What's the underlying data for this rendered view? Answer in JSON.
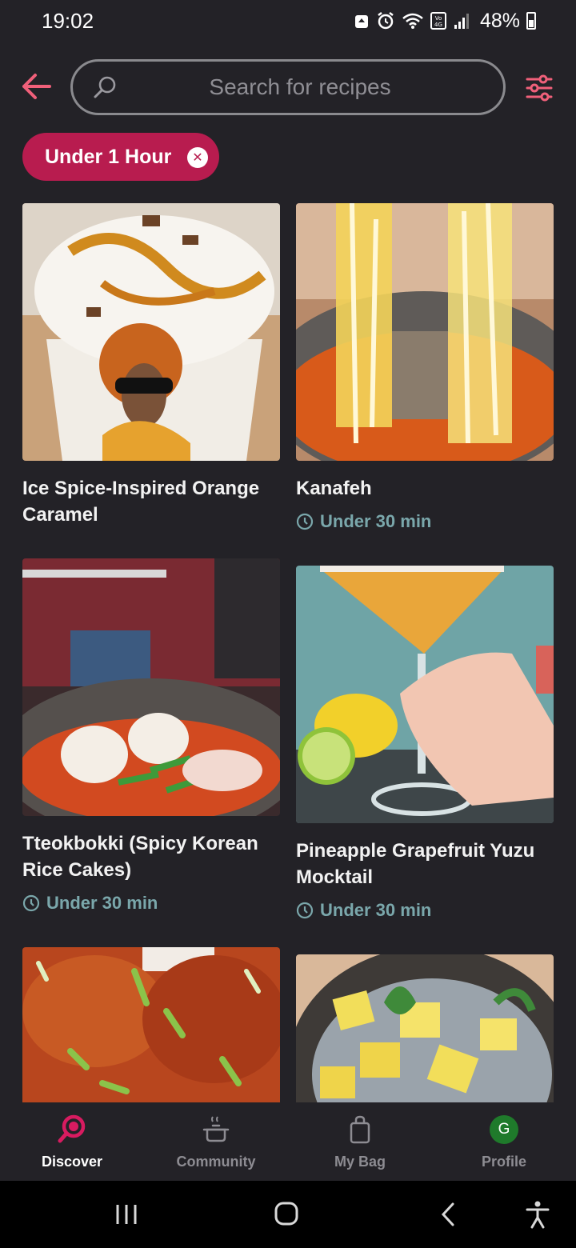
{
  "status_bar": {
    "time": "19:02",
    "battery": "48%",
    "icons": [
      "recycle-icon",
      "alarm-icon",
      "wifi-icon",
      "volte-icon",
      "signal-icon",
      "battery-icon"
    ]
  },
  "header": {
    "back_icon": "arrow-left-icon",
    "search_placeholder": "Search for recipes",
    "search_value": "",
    "filter_icon": "sliders-icon"
  },
  "filters": {
    "active_chip": "Under 1 Hour"
  },
  "colors": {
    "background": "#232227",
    "accent": "#b81c4f",
    "time_text": "#7aa7ab",
    "nav_inactive": "#8d8c92"
  },
  "recipes": [
    {
      "title": "Ice Spice-Inspired Orange Caramel",
      "time": ""
    },
    {
      "title": "Kanafeh",
      "time": "Under 30 min"
    },
    {
      "title": "Tteokbokki (Spicy Korean Rice Cakes)",
      "time": "Under 30 min"
    },
    {
      "title": "Pineapple Grapefruit Yuzu Mocktail",
      "time": "Under 30 min"
    },
    {
      "title": "",
      "time": ""
    },
    {
      "title": "",
      "time": ""
    }
  ],
  "bottom_nav": {
    "items": [
      {
        "label": "Discover",
        "icon": "search-icon",
        "active": true
      },
      {
        "label": "Community",
        "icon": "pot-icon",
        "active": false
      },
      {
        "label": "My Bag",
        "icon": "bag-icon",
        "active": false
      },
      {
        "label": "Profile",
        "icon": "avatar",
        "active": false
      }
    ],
    "avatar_initial": "G"
  },
  "system_nav": [
    "recents-icon",
    "home-icon",
    "back-icon",
    "accessibility-icon"
  ]
}
